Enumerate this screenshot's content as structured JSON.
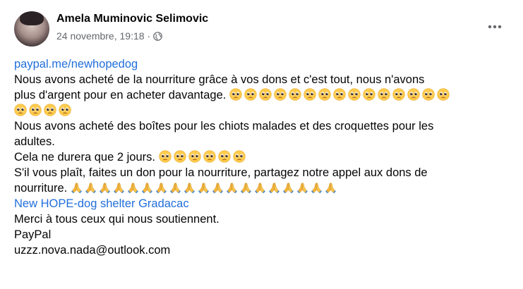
{
  "author": {
    "name": "Amela Muminovic Selimovic",
    "timestamp": "24 novembre, 19:18",
    "separator": "·",
    "audience_icon": "globe-icon"
  },
  "menu_icon": "more-options-icon",
  "post": {
    "link_paypal": "paypal.me/newhopedog",
    "para1_line1": "Nous avons acheté de la nourriture grâce à vos dons et c'est tout, nous n'avons",
    "para1_line2": "plus d'argent pour en acheter davantage.",
    "para1_emoji_count_line2": 15,
    "para1_emoji_count_line3": 4,
    "para2_line1": "Nous avons acheté des boîtes pour les chiots malades et des croquettes pour les",
    "para2_line2": "adultes.",
    "para3": "Cela ne durera que 2 jours.",
    "para3_emoji_count": 6,
    "para4_line1": "S'il vous plaît, faites un don pour la nourriture, partagez notre appel aux dons de",
    "para4_line2": "nourriture.",
    "para4_emoji_count": 19,
    "page_link": "New HOPE-dog shelter Gradacac",
    "thanks": "Merci à tous ceux qui nous soutiennent.",
    "paypal_label": "PayPal",
    "email": "uzzz.nova.nada@outlook.com",
    "emoji_sad": "pleading-face-emoji",
    "emoji_pray": "folded-hands-emoji"
  },
  "colors": {
    "link": "#216fdb",
    "meta": "#65676b",
    "text": "#050505"
  }
}
